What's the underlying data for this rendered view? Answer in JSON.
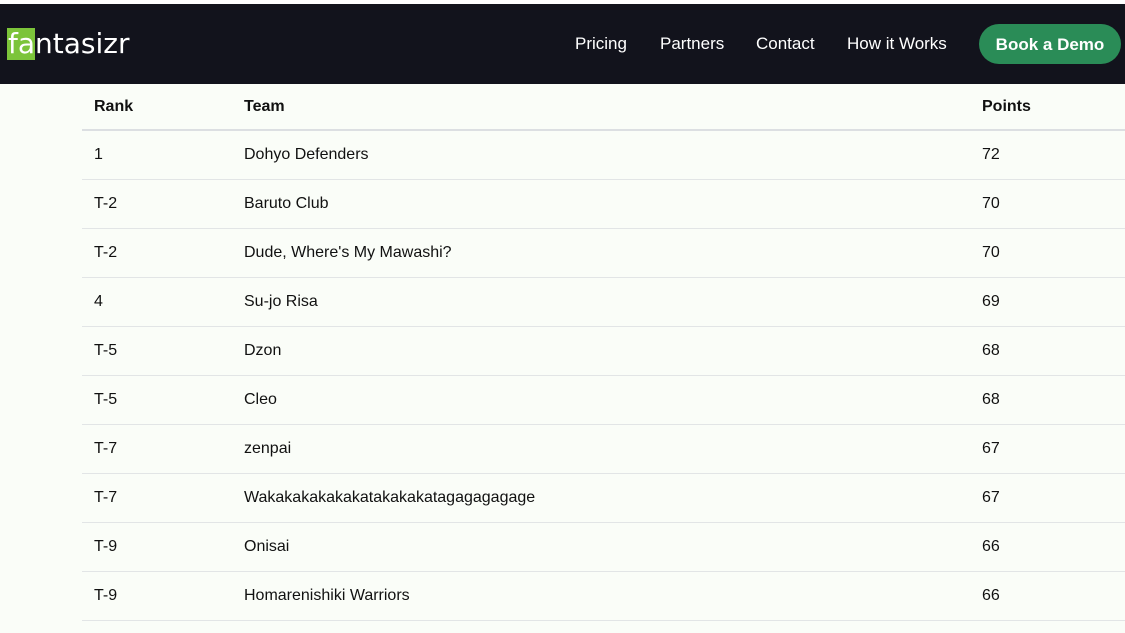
{
  "header": {
    "logo": {
      "mark": "fa",
      "rest": "ntasizr"
    },
    "nav": {
      "pricing": "Pricing",
      "partners": "Partners",
      "contact": "Contact",
      "how_it_works": "How it Works"
    },
    "cta_label": "Book a Demo"
  },
  "leaderboard": {
    "columns": {
      "rank": "Rank",
      "team": "Team",
      "points": "Points"
    },
    "rows": [
      {
        "rank": "1",
        "team": "Dohyo Defenders",
        "points": "72"
      },
      {
        "rank": "T-2",
        "team": "Baruto Club",
        "points": "70"
      },
      {
        "rank": "T-2",
        "team": "Dude, Where's My Mawashi?",
        "points": "70"
      },
      {
        "rank": "4",
        "team": "Su-jo Risa",
        "points": "69"
      },
      {
        "rank": "T-5",
        "team": "Dzon",
        "points": "68"
      },
      {
        "rank": "T-5",
        "team": "Cleo",
        "points": "68"
      },
      {
        "rank": "T-7",
        "team": "zenpai",
        "points": "67"
      },
      {
        "rank": "T-7",
        "team": "Wakakakakakakatakakakatagagagagage",
        "points": "67"
      },
      {
        "rank": "T-9",
        "team": "Onisai",
        "points": "66"
      },
      {
        "rank": "T-9",
        "team": "Homarenishiki Warriors",
        "points": "66"
      }
    ]
  },
  "colors": {
    "navbar_bg": "#12131c",
    "logo_accent": "#7cc43a",
    "cta_bg": "#2a8c57",
    "page_bg": "#fafdf8"
  }
}
